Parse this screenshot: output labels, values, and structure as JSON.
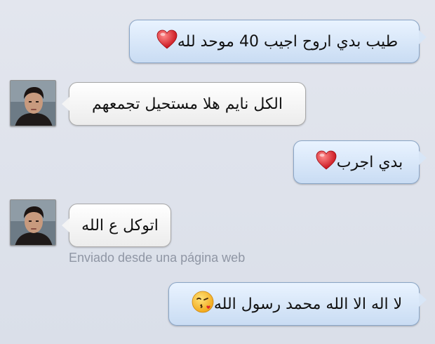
{
  "messages": [
    {
      "direction": "outgoing",
      "text": "طيب بدي اروح اجيب 40 موحد لله",
      "icon": "heart-icon"
    },
    {
      "direction": "incoming",
      "text": "الكل نايم هلا مستحيل تجمعهم",
      "avatar": "contact-avatar"
    },
    {
      "direction": "outgoing",
      "text": "بدي اجرب",
      "icon": "heart-icon"
    },
    {
      "direction": "incoming",
      "text": "اتوكل ع الله",
      "avatar": "contact-avatar"
    },
    {
      "direction": "outgoing",
      "text": "لا اله الا الله محمد رسول الله",
      "icon": "kissing-face-emoji-icon"
    }
  ],
  "web_notice": "Enviado desde una página web",
  "colors": {
    "outgoing_bubble": "#c9dcf3",
    "incoming_bubble": "#ffffff",
    "background": "#dfe3ec",
    "heart": "#e0262c",
    "notice_text": "#8f96a4"
  }
}
